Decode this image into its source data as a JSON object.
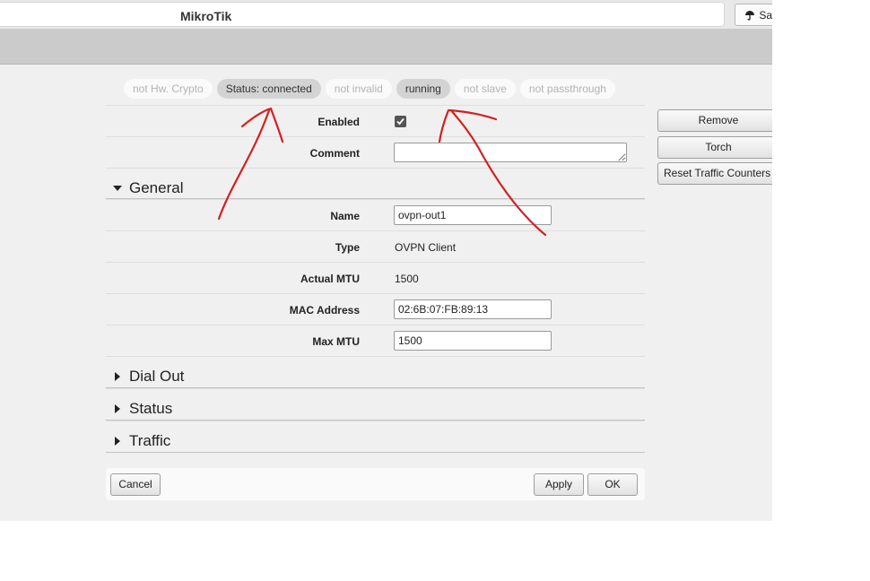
{
  "app": {
    "title": "MikroTik"
  },
  "toolbar": {
    "save_label": "Safe Mode"
  },
  "flags": [
    {
      "label": "not Hw. Crypto",
      "active": false
    },
    {
      "label": "Status: connected",
      "active": true
    },
    {
      "label": "not invalid",
      "active": false
    },
    {
      "label": "running",
      "active": true
    },
    {
      "label": "not slave",
      "active": false
    },
    {
      "label": "not passthrough",
      "active": false
    }
  ],
  "form": {
    "enabled": {
      "label": "Enabled",
      "checked": true
    },
    "comment": {
      "label": "Comment",
      "value": ""
    },
    "general": {
      "label": "General",
      "expanded": true
    },
    "name": {
      "label": "Name",
      "value": "ovpn-out1"
    },
    "type": {
      "label": "Type",
      "value": "OVPN Client"
    },
    "actual_mtu": {
      "label": "Actual MTU",
      "value": "1500"
    },
    "mac_address": {
      "label": "MAC Address",
      "value": "02:6B:07:FB:89:13"
    },
    "max_mtu": {
      "label": "Max MTU",
      "value": "1500"
    },
    "sections": [
      {
        "label": "Dial Out",
        "expanded": false
      },
      {
        "label": "Status",
        "expanded": false
      },
      {
        "label": "Traffic",
        "expanded": false
      }
    ]
  },
  "footer": {
    "cancel": "Cancel",
    "apply": "Apply",
    "ok": "OK"
  },
  "side_actions": {
    "remove": "Remove",
    "torch": "Torch",
    "reset": "Reset Traffic Counters"
  },
  "colors": {
    "annotation": "#d42020",
    "flag_active": "#d3d3d3",
    "header_gray": "#cbcbcb",
    "panel_bg": "#f0f0f0"
  }
}
